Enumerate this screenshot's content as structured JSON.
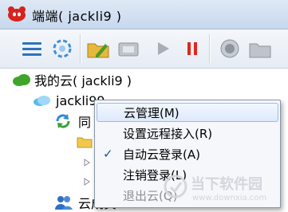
{
  "window": {
    "title": "端端( jackli9 )"
  },
  "tree": {
    "root_label": "我的云( jackli9 )",
    "cloud_label": "jackli99",
    "sync_label": "同",
    "share_label": "云成员"
  },
  "context_menu": {
    "items": [
      {
        "label": "云管理(M)",
        "state": "hover"
      },
      {
        "label": "设置远程接入(R)",
        "state": "normal"
      },
      {
        "label": "自动云登录(A)",
        "state": "checked"
      },
      {
        "label": "注销登录(L)",
        "state": "normal"
      },
      {
        "label": "退出云(Q)",
        "state": "disabled"
      }
    ]
  },
  "watermark": {
    "cn": "当下软件园",
    "url": "www.downxia.com"
  },
  "colors": {
    "accent": "#2f6fc6",
    "pause": "#e0261f",
    "checkmark": "#1b4fa8"
  }
}
